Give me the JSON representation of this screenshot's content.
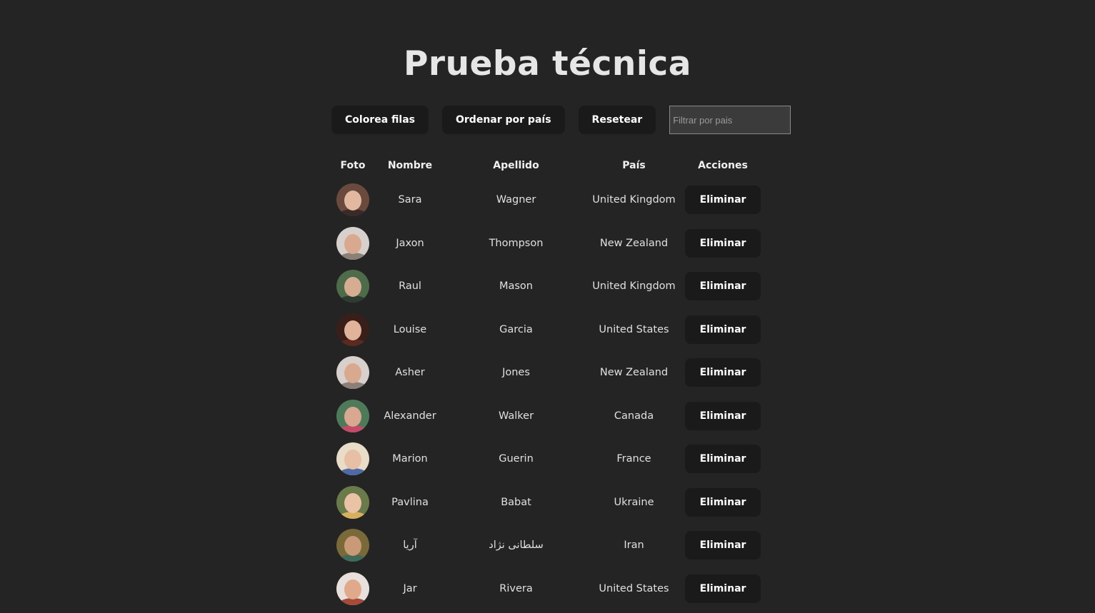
{
  "title": "Prueba técnica",
  "toolbar": {
    "color_rows_label": "Colorea filas",
    "sort_country_label": "Ordenar por país",
    "reset_label": "Resetear",
    "filter_placeholder": "Filtrar por pais"
  },
  "table": {
    "headers": {
      "photo": "Foto",
      "first_name": "Nombre",
      "last_name": "Apellido",
      "country": "País",
      "actions": "Acciones"
    },
    "delete_label": "Eliminar",
    "rows": [
      {
        "first": "Sara",
        "last": "Wagner",
        "country": "United Kingdom",
        "avatar": {
          "bg": "#6b4a3e",
          "skin": "#e2b8a0",
          "shirt": "#3a2a28"
        }
      },
      {
        "first": "Jaxon",
        "last": "Thompson",
        "country": "New Zealand",
        "avatar": {
          "bg": "#d8d0cc",
          "skin": "#d9a98f",
          "shirt": "#8a8078"
        }
      },
      {
        "first": "Raul",
        "last": "Mason",
        "country": "United Kingdom",
        "avatar": {
          "bg": "#4e6b4a",
          "skin": "#d6ad92",
          "shirt": "#2e3b30"
        }
      },
      {
        "first": "Louise",
        "last": "Garcia",
        "country": "United States",
        "avatar": {
          "bg": "#3a1e1a",
          "skin": "#e0b39a",
          "shirt": "#5a2a20"
        }
      },
      {
        "first": "Asher",
        "last": "Jones",
        "country": "New Zealand",
        "avatar": {
          "bg": "#d8d0cc",
          "skin": "#d9a98f",
          "shirt": "#8a8078"
        }
      },
      {
        "first": "Alexander",
        "last": "Walker",
        "country": "Canada",
        "avatar": {
          "bg": "#4f7a5a",
          "skin": "#d8a890",
          "shirt": "#c44a6a"
        }
      },
      {
        "first": "Marion",
        "last": "Guerin",
        "country": "France",
        "avatar": {
          "bg": "#e9dcc8",
          "skin": "#e6bfa4",
          "shirt": "#4e6aa8"
        }
      },
      {
        "first": "Pavlina",
        "last": "Babat",
        "country": "Ukraine",
        "avatar": {
          "bg": "#6a7a4a",
          "skin": "#eac2a6",
          "shirt": "#d6b060"
        }
      },
      {
        "first": "آریا",
        "last": "سلطانی نژاد",
        "country": "Iran",
        "avatar": {
          "bg": "#7a6a3a",
          "skin": "#c99a78",
          "shirt": "#3f6a5a"
        }
      },
      {
        "first": "Jar",
        "last": "Rivera",
        "country": "United States",
        "avatar": {
          "bg": "#e8e0dc",
          "skin": "#e0a98c",
          "shirt": "#a64a3a"
        }
      }
    ]
  }
}
